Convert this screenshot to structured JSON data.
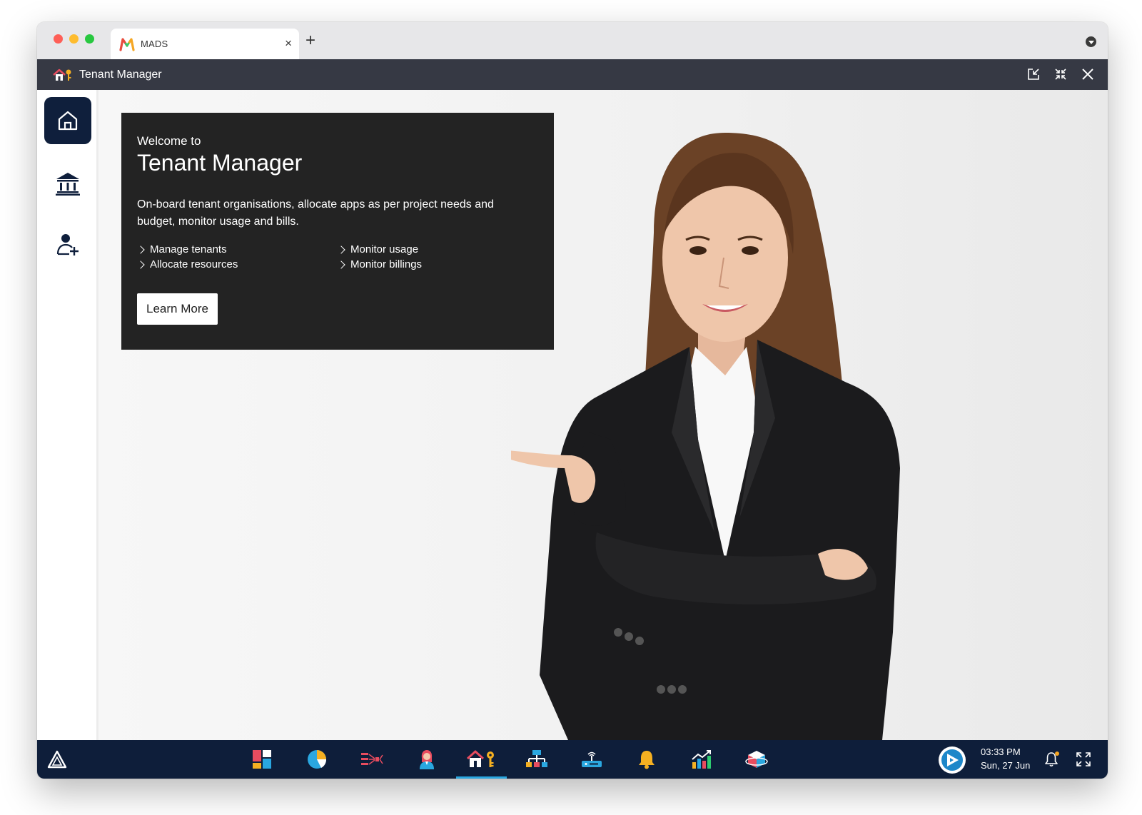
{
  "browser": {
    "tab_title": "MADS",
    "tab_close": "×",
    "new_tab": "+"
  },
  "app": {
    "title": "Tenant Manager",
    "actions": [
      "popout-icon",
      "collapse-icon",
      "close-icon"
    ]
  },
  "sidebar": {
    "items": [
      {
        "name": "home",
        "icon": "home-icon",
        "active": true
      },
      {
        "name": "organisations",
        "icon": "bank-icon",
        "active": false
      },
      {
        "name": "add-user",
        "icon": "add-user-icon",
        "active": false
      }
    ]
  },
  "welcome": {
    "small_title": "Welcome to",
    "big_title": "Tenant Manager",
    "description": "On-board tenant organisations, allocate apps as per project needs and budget, monitor usage and bills.",
    "features": [
      "Manage tenants",
      "Monitor usage",
      "Allocate resources",
      "Monitor billings"
    ],
    "button_label": "Learn More"
  },
  "taskbar": {
    "apps": [
      {
        "name": "dashboard",
        "icon": "tiles-icon",
        "active": false
      },
      {
        "name": "analytics",
        "icon": "pie-chart-icon",
        "active": false
      },
      {
        "name": "pipeline",
        "icon": "flow-icon",
        "active": false
      },
      {
        "name": "user",
        "icon": "woman-avatar-icon",
        "active": false
      },
      {
        "name": "tenant-manager",
        "icon": "house-key-icon",
        "active": true
      },
      {
        "name": "hierarchy",
        "icon": "org-chart-icon",
        "active": false
      },
      {
        "name": "device",
        "icon": "router-icon",
        "active": false
      },
      {
        "name": "alerts",
        "icon": "bell-icon",
        "active": false
      },
      {
        "name": "reports",
        "icon": "growth-chart-icon",
        "active": false
      },
      {
        "name": "packages",
        "icon": "cube-icon",
        "active": false
      }
    ],
    "time": "03:33 PM",
    "date": "Sun, 27 Jun",
    "colors": {
      "bar": "#0e1e3a",
      "active_underline": "#2aa7e0",
      "notification_dot": "#f5a623"
    }
  },
  "colors": {
    "appbar": "#363944",
    "sidebar_active": "#0f1f3c",
    "welcome_panel": "#232323"
  }
}
